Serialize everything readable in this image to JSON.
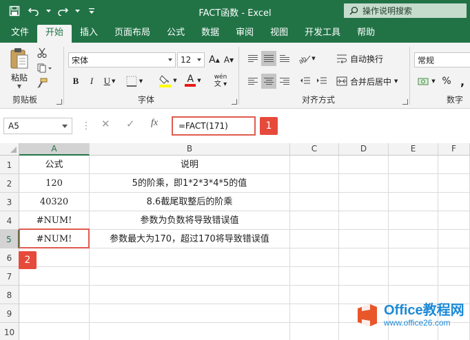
{
  "window": {
    "title": "FACT函数 - Excel"
  },
  "search": {
    "label": "操作说明搜索"
  },
  "tabs": [
    "文件",
    "开始",
    "插入",
    "页面布局",
    "公式",
    "数据",
    "审阅",
    "视图",
    "开发工具",
    "帮助"
  ],
  "active_tab": "开始",
  "ribbon": {
    "clipboard": {
      "paste_label": "粘贴",
      "group_label": "剪贴板"
    },
    "font": {
      "font_name": "宋体",
      "font_size": "12",
      "grow": "A",
      "shrink": "A",
      "bold": "B",
      "italic": "I",
      "underline": "U",
      "font_color_letter": "A",
      "phonetic": "wén",
      "group_label": "字体"
    },
    "alignment": {
      "wrap_text": "自动换行",
      "merge_center": "合并后居中",
      "group_label": "对齐方式"
    },
    "number": {
      "format": "常规",
      "percent": "%",
      "group_label": "数字"
    }
  },
  "formula_bar": {
    "name_box": "A5",
    "cancel": "✕",
    "enter": "✓",
    "fx": "fx",
    "formula": "=FACT(171)"
  },
  "callouts": {
    "first": "1",
    "second": "2"
  },
  "columns": [
    "A",
    "B",
    "C",
    "D",
    "E",
    "F"
  ],
  "rows": [
    "1",
    "2",
    "3",
    "4",
    "5",
    "6",
    "7",
    "8",
    "9",
    "10"
  ],
  "table": {
    "header": {
      "a": "公式",
      "b": "说明"
    },
    "rows": [
      {
        "a": "120",
        "b": "5的阶乘，即1*2*3*4*5的值"
      },
      {
        "a": "40320",
        "b": "8.6截尾取整后的阶乘"
      },
      {
        "a": "#NUM!",
        "b": "参数为负数将导致错误值"
      },
      {
        "a": "#NUM!",
        "b": "参数最大为170，超过170将导致错误值"
      }
    ]
  },
  "watermark": {
    "line1": "Office教程网",
    "line2": "www.office26.com"
  },
  "colors": {
    "brand": "#217346",
    "callout": "#e64a3b",
    "watermark": "#1c8ad6"
  }
}
